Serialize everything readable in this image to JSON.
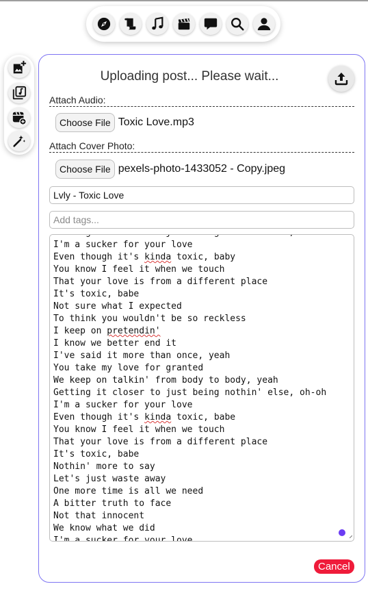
{
  "nav": {
    "items": [
      {
        "name": "explore",
        "icon": "compass-icon"
      },
      {
        "name": "feed",
        "icon": "scroll-icon"
      },
      {
        "name": "music",
        "icon": "music-note-icon"
      },
      {
        "name": "videos",
        "icon": "clapperboard-icon"
      },
      {
        "name": "messages",
        "icon": "speech-bubble-icon"
      },
      {
        "name": "search",
        "icon": "search-icon"
      },
      {
        "name": "profile",
        "icon": "user-icon"
      }
    ]
  },
  "tools": {
    "items": [
      {
        "name": "add-image",
        "icon": "add-photo-icon"
      },
      {
        "name": "music-library",
        "icon": "music-library-icon"
      },
      {
        "name": "add-video",
        "icon": "video-library-add-icon"
      },
      {
        "name": "magic",
        "icon": "magic-wand-icon"
      }
    ]
  },
  "form": {
    "status_text": "Uploading post... Please wait...",
    "audio": {
      "label": "Attach Audio:",
      "button": "Choose File",
      "file_name": "Toxic Love.mp3"
    },
    "cover": {
      "label": "Attach Cover Photo:",
      "button": "Choose File",
      "file_name": "pexels-photo-1433052 - Copy.jpeg"
    },
    "title_value": "Lvly - Toxic Love",
    "tags_placeholder": "Add tags...",
    "lyrics_lines": [
      "Getting it closer to just being nothin' else, oh-oh",
      "I'm a sucker for your love",
      "Even though it's kinda toxic, baby",
      "You know I feel it when we touch",
      "That your love is from a different place",
      "It's toxic, babe",
      "Not sure what I expected",
      "To think you wouldn't be so reckless",
      "I keep on pretendin'",
      "I know we better end it",
      "I've said it more than once, yeah",
      "You take my love for granted",
      "We keep on talkin' from body to body, yeah",
      "Getting it closer to just being nothin' else, oh-oh",
      "I'm a sucker for your love",
      "Even though it's kinda toxic, babe",
      "You know I feel it when we touch",
      "That your love is from a different place",
      "It's toxic, babe",
      "Nothin' more to say",
      "Let's just waste away",
      "One more time is all we need",
      "A bitter truth to face",
      "Not that innocent",
      "We know what we did",
      "I'm a sucker for your love"
    ],
    "misspelled_words": [
      "kinda",
      "pretendin'"
    ],
    "cancel_label": "Cancel"
  },
  "colors": {
    "card_border": "#7d74f3",
    "cancel_bg": "#ef1b3a",
    "resize_dot": "#6b3cf3"
  }
}
